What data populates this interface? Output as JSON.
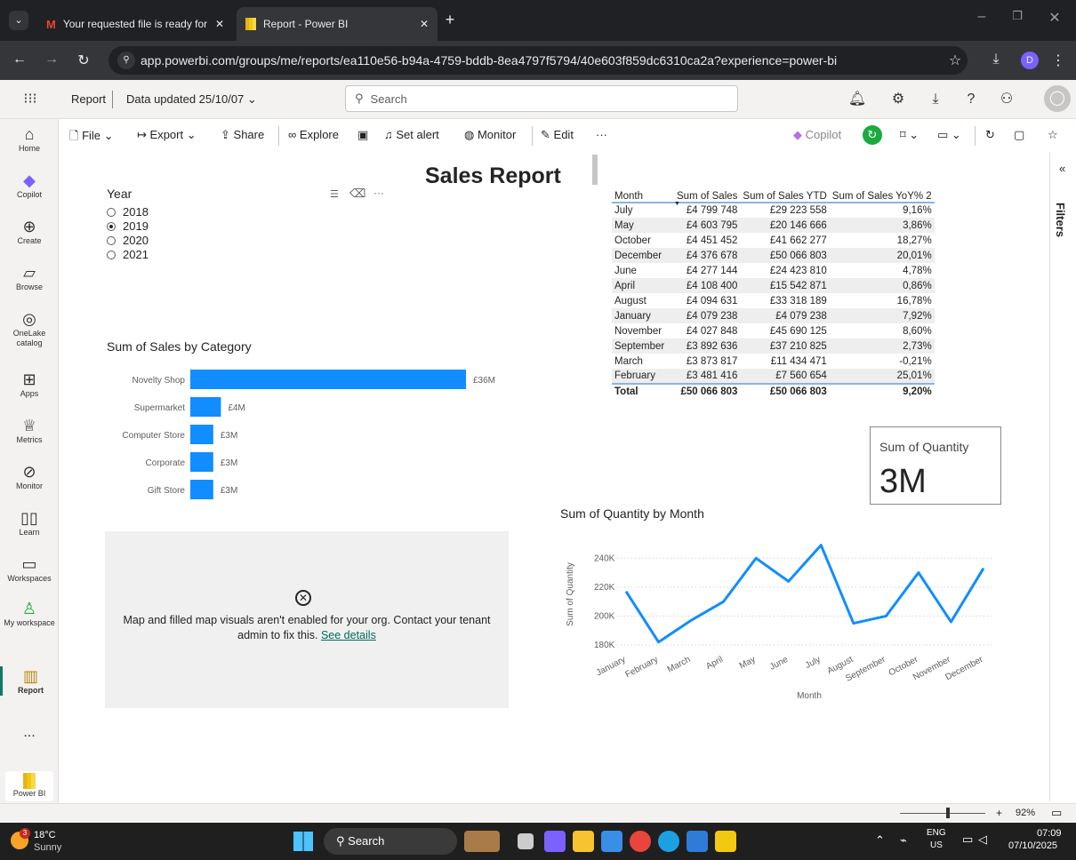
{
  "browser": {
    "tabs": [
      {
        "title": "Your requested file is ready for",
        "active": false
      },
      {
        "title": "Report - Power BI",
        "active": true
      }
    ],
    "url": "app.powerbi.com/groups/me/reports/ea110e56-b94a-4759-bddb-8ea4797f5794/40e603f859dc6310ca2a?experience=power-bi",
    "profile_initial": "D"
  },
  "header": {
    "report_label": "Report",
    "data_updated": "Data updated 25/10/07",
    "search_placeholder": "Search"
  },
  "nav": [
    {
      "label": "Home",
      "icon": "home-icon"
    },
    {
      "label": "Copilot",
      "icon": "copilot-icon"
    },
    {
      "label": "Create",
      "icon": "plus-circle-icon"
    },
    {
      "label": "Browse",
      "icon": "folder-icon"
    },
    {
      "label": "OneLake catalog",
      "icon": "onelake-icon"
    },
    {
      "label": "Apps",
      "icon": "apps-icon"
    },
    {
      "label": "Metrics",
      "icon": "trophy-icon"
    },
    {
      "label": "Monitor",
      "icon": "monitor-icon"
    },
    {
      "label": "Learn",
      "icon": "book-icon"
    },
    {
      "label": "Workspaces",
      "icon": "workspaces-icon"
    },
    {
      "label": "My workspace",
      "icon": "person-icon"
    },
    {
      "label": "Report",
      "icon": "report-icon"
    }
  ],
  "nav_more": "...",
  "nav_powerbi": "Power BI",
  "toolbar": {
    "file": "File",
    "export": "Export",
    "share": "Share",
    "explore": "Explore",
    "set_alert": "Set alert",
    "monitor": "Monitor",
    "edit": "Edit",
    "more": "···",
    "copilot": "Copilot"
  },
  "filters_label": "Filters",
  "report": {
    "title": "Sales Report",
    "slicer": {
      "title": "Year",
      "options": [
        "2018",
        "2019",
        "2020",
        "2021"
      ],
      "selected": "2019"
    },
    "table": {
      "headers": [
        "Month",
        "Sum of Sales",
        "Sum of Sales YTD",
        "Sum of Sales YoY% 2"
      ],
      "rows": [
        [
          "July",
          "£4 799 748",
          "£29 223 558",
          "9,16%"
        ],
        [
          "May",
          "£4 603 795",
          "£20 146 666",
          "3,86%"
        ],
        [
          "October",
          "£4 451 452",
          "£41 662 277",
          "18,27%"
        ],
        [
          "December",
          "£4 376 678",
          "£50 066 803",
          "20,01%"
        ],
        [
          "June",
          "£4 277 144",
          "£24 423 810",
          "4,78%"
        ],
        [
          "April",
          "£4 108 400",
          "£15 542 871",
          "0,86%"
        ],
        [
          "August",
          "£4 094 631",
          "£33 318 189",
          "16,78%"
        ],
        [
          "January",
          "£4 079 238",
          "£4 079 238",
          "7,92%"
        ],
        [
          "November",
          "£4 027 848",
          "£45 690 125",
          "8,60%"
        ],
        [
          "September",
          "£3 892 636",
          "£37 210 825",
          "2,73%"
        ],
        [
          "March",
          "£3 873 817",
          "£11 434 471",
          "-0,21%"
        ],
        [
          "February",
          "£3 481 416",
          "£7 560 654",
          "25,01%"
        ]
      ],
      "total": [
        "Total",
        "£50 066 803",
        "£50 066 803",
        "9,20%"
      ]
    },
    "card": {
      "label": "Sum of Quantity",
      "value": "3M"
    },
    "map_error": {
      "message": "Map and filled map visuals aren't enabled for your org. Contact your tenant admin to fix this.",
      "link": "See details"
    }
  },
  "chart_data": [
    {
      "type": "bar",
      "orientation": "horizontal",
      "title": "Sum of Sales by Category",
      "categories": [
        "Novelty Shop",
        "Supermarket",
        "Computer Store",
        "Corporate",
        "Gift Store"
      ],
      "values": [
        36,
        4,
        3,
        3,
        3
      ],
      "data_labels": [
        "£36M",
        "£4M",
        "£3M",
        "£3M",
        "£3M"
      ],
      "color": "#118dff"
    },
    {
      "type": "line",
      "title": "Sum of Quantity by Month",
      "xlabel": "Month",
      "ylabel": "Sum of Quantity",
      "x": [
        "January",
        "February",
        "March",
        "April",
        "May",
        "June",
        "July",
        "August",
        "September",
        "October",
        "November",
        "December"
      ],
      "values": [
        217000,
        182000,
        197000,
        210000,
        240000,
        224000,
        249000,
        195000,
        200000,
        230000,
        196000,
        233000
      ],
      "yticks": [
        "180K",
        "200K",
        "220K",
        "240K"
      ],
      "ylim": [
        180000,
        250000
      ],
      "grid": true,
      "color": "#118dff"
    }
  ],
  "statusbar": {
    "zoom": "92%"
  },
  "taskbar": {
    "badge": "3",
    "temp": "18°C",
    "weather": "Sunny",
    "search": "Search",
    "lang1": "ENG",
    "lang2": "US",
    "time": "07:09",
    "date": "07/10/2025"
  }
}
